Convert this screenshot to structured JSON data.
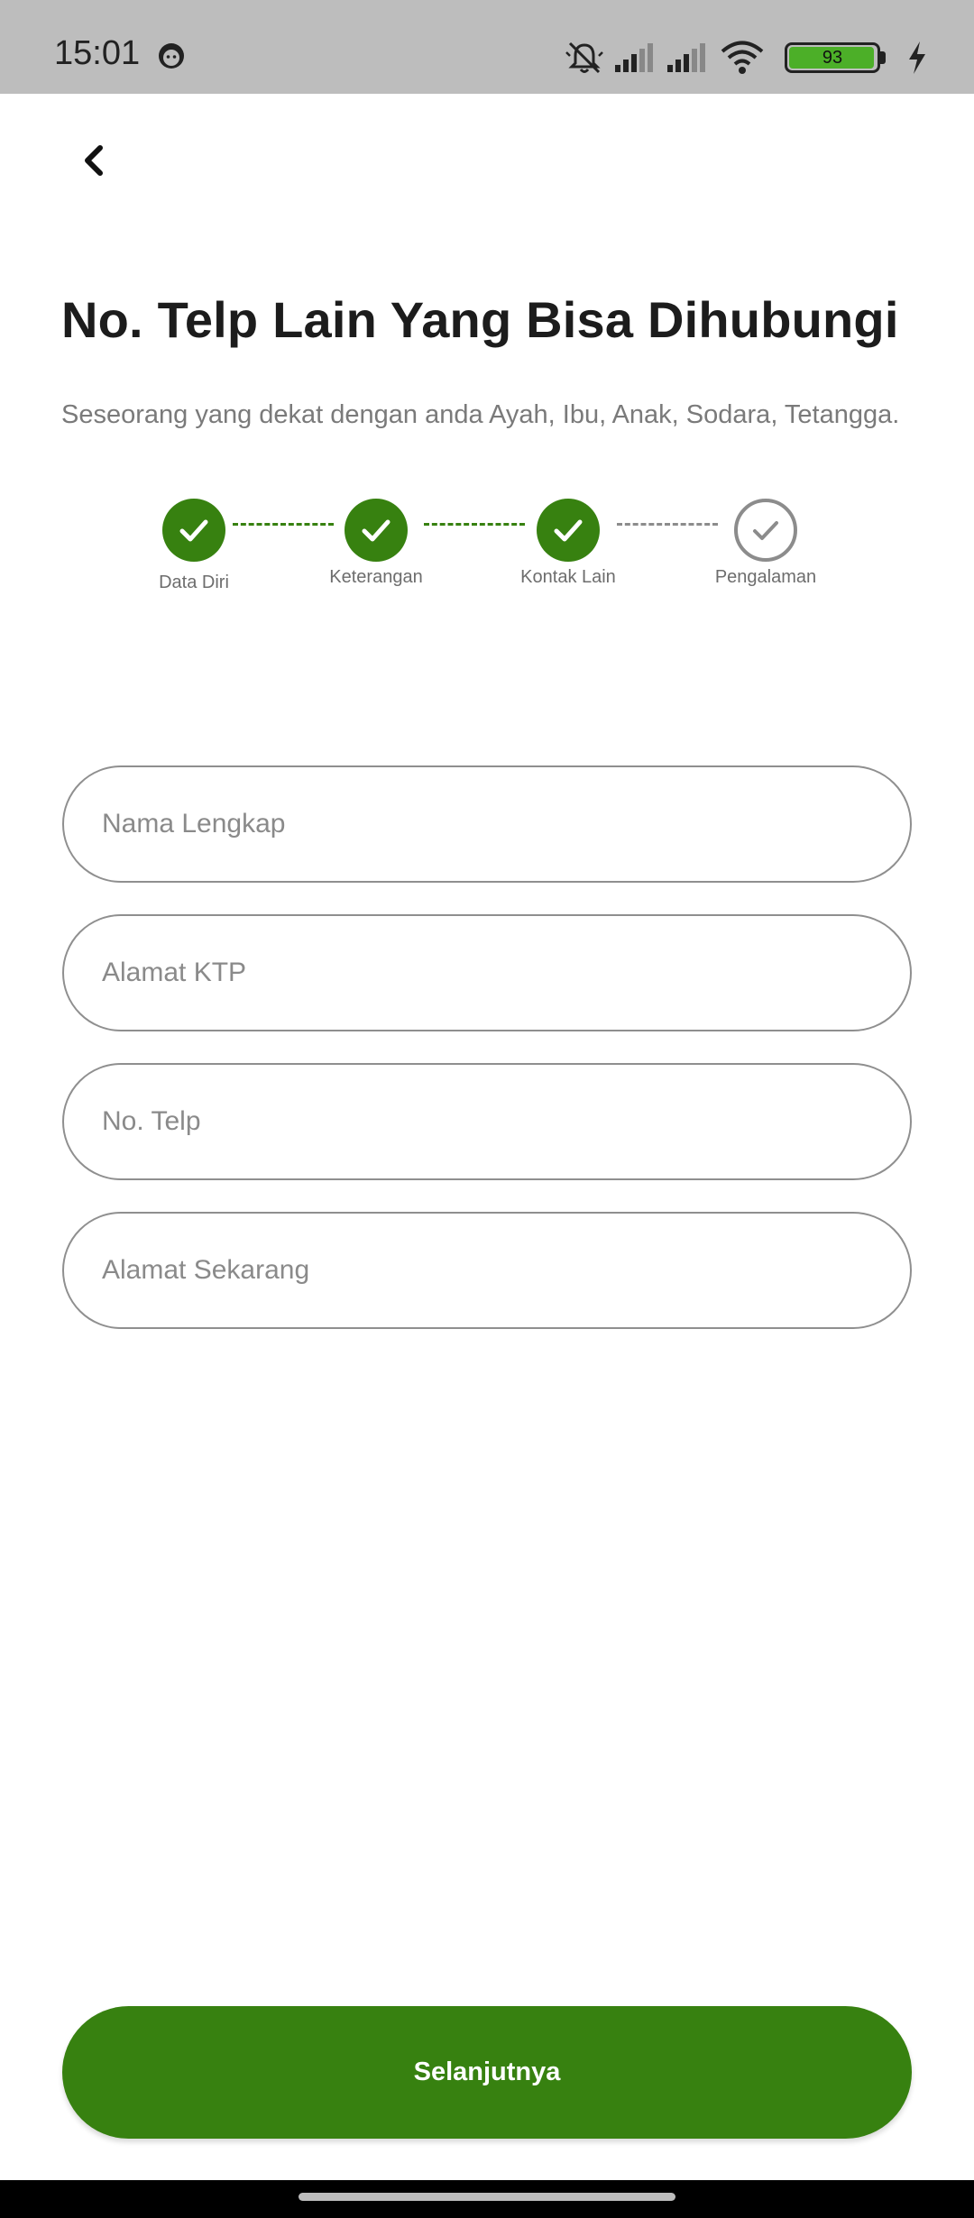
{
  "status_bar": {
    "time": "15:01",
    "battery_level": "93",
    "icons": [
      "face-icon",
      "mute-icon",
      "signal-icon",
      "signal-icon",
      "wifi-icon",
      "battery-icon",
      "charging-icon"
    ]
  },
  "header": {
    "back_icon": "chevron-left-icon",
    "title": "No. Telp Lain Yang Bisa Dihubungi",
    "subtitle": "Seseorang yang dekat dengan anda Ayah, Ibu, Anak, Sodara, Tetangga."
  },
  "stepper": {
    "steps": [
      {
        "label": "Data Diri",
        "status": "done"
      },
      {
        "label": "Keterangan",
        "status": "done"
      },
      {
        "label": "Kontak Lain",
        "status": "done"
      },
      {
        "label": "Pengalaman",
        "status": "pending"
      }
    ],
    "active_color": "#378110",
    "inactive_color": "#8c8c8c"
  },
  "form": {
    "fields": [
      {
        "placeholder": "Nama Lengkap",
        "value": ""
      },
      {
        "placeholder": "Alamat KTP",
        "value": ""
      },
      {
        "placeholder": "No. Telp",
        "value": ""
      },
      {
        "placeholder": "Alamat Sekarang",
        "value": ""
      }
    ]
  },
  "footer": {
    "next_label": "Selanjutnya",
    "button_color": "#378110"
  }
}
